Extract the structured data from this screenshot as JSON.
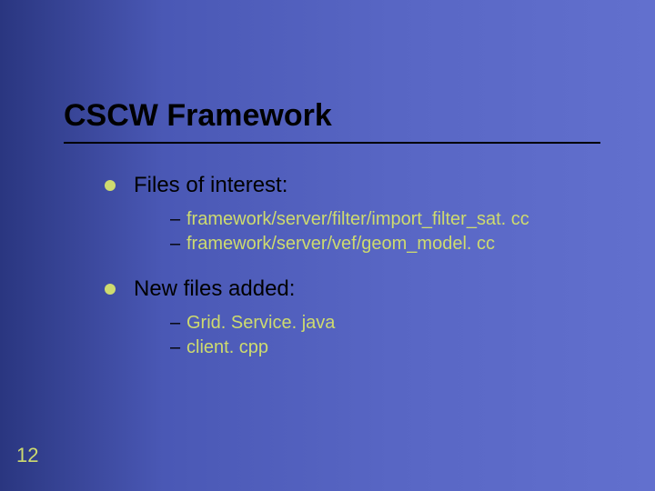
{
  "title": "CSCW Framework",
  "page_number": "12",
  "body": {
    "items": [
      {
        "label": "Files of interest:",
        "subitems": [
          "framework/server/filter/import_filter_sat. cc",
          "framework/server/vef/geom_model. cc"
        ]
      },
      {
        "label": "New files added:",
        "subitems": [
          "Grid. Service. java",
          "client. cpp"
        ]
      }
    ]
  }
}
